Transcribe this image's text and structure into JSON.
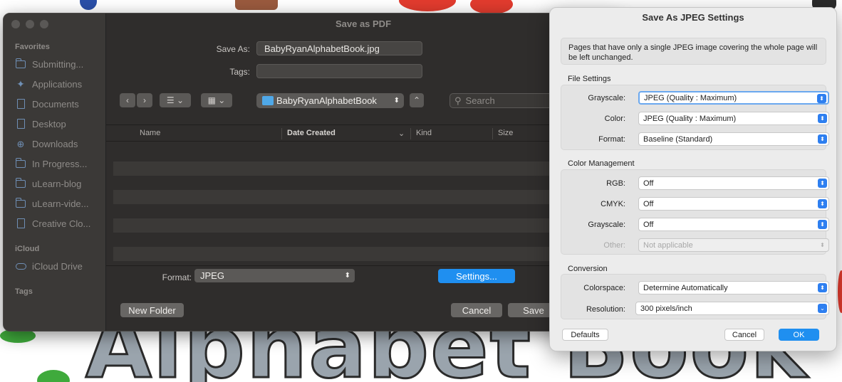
{
  "save_dialog": {
    "title": "Save as PDF",
    "save_as_label": "Save As:",
    "save_as_value": "BabyRyanAlphabetBook.jpg",
    "tags_label": "Tags:",
    "tags_value": "",
    "location": "BabyRyanAlphabetBook",
    "search_placeholder": "Search",
    "columns": [
      "Name",
      "Date Created",
      "Kind",
      "Size"
    ],
    "format_label": "Format:",
    "format_value": "JPEG",
    "settings_label": "Settings...",
    "new_folder_label": "New Folder",
    "cancel_label": "Cancel",
    "save_label": "Save"
  },
  "sidebar": {
    "favorites_heading": "Favorites",
    "favorites": [
      {
        "label": "Submitting...",
        "icon": "folder-icon"
      },
      {
        "label": "Applications",
        "icon": "applications-icon"
      },
      {
        "label": "Documents",
        "icon": "document-icon"
      },
      {
        "label": "Desktop",
        "icon": "desktop-icon"
      },
      {
        "label": "Downloads",
        "icon": "downloads-icon"
      },
      {
        "label": "In Progress...",
        "icon": "folder-icon"
      },
      {
        "label": "uLearn-blog",
        "icon": "folder-icon"
      },
      {
        "label": "uLearn-vide...",
        "icon": "folder-icon"
      },
      {
        "label": "Creative Clo...",
        "icon": "document-icon"
      }
    ],
    "icloud_heading": "iCloud",
    "icloud": [
      {
        "label": "iCloud Drive",
        "icon": "cloud-icon"
      }
    ],
    "tags_heading": "Tags"
  },
  "jpeg_settings": {
    "title": "Save As JPEG Settings",
    "note": "Pages that have only a single JPEG image covering the whole page will be left unchanged.",
    "file_settings": {
      "heading": "File Settings",
      "grayscale_label": "Grayscale:",
      "grayscale_value": "JPEG (Quality : Maximum)",
      "color_label": "Color:",
      "color_value": "JPEG (Quality : Maximum)",
      "format_label": "Format:",
      "format_value": "Baseline (Standard)"
    },
    "color_management": {
      "heading": "Color Management",
      "rgb_label": "RGB:",
      "rgb_value": "Off",
      "cmyk_label": "CMYK:",
      "cmyk_value": "Off",
      "grayscale_label": "Grayscale:",
      "grayscale_value": "Off",
      "other_label": "Other:",
      "other_value": "Not applicable"
    },
    "conversion": {
      "heading": "Conversion",
      "colorspace_label": "Colorspace:",
      "colorspace_value": "Determine Automatically",
      "resolution_label": "Resolution:",
      "resolution_value": "300 pixels/inch"
    },
    "defaults_label": "Defaults",
    "cancel_label": "Cancel",
    "ok_label": "OK"
  },
  "background": {
    "text": "Alphabet Book"
  },
  "colors": {
    "accent": "#1f8ff0",
    "window_dark": "#2f2d2c",
    "dialog_light": "#ececec"
  }
}
